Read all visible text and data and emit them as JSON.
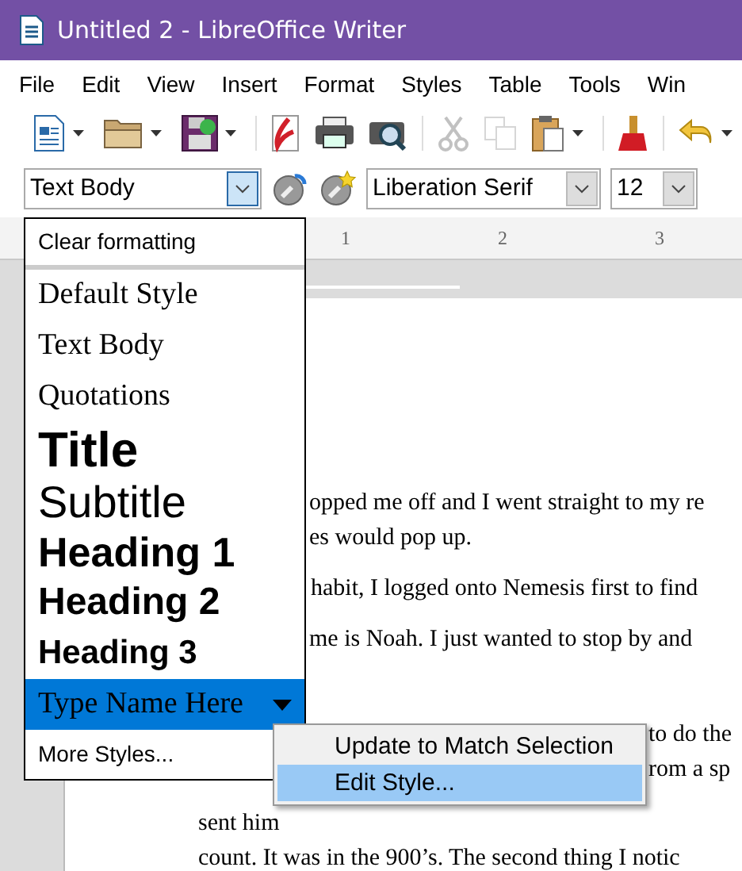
{
  "window": {
    "title": "Untitled 2 - LibreOffice Writer"
  },
  "menu_bar": [
    "File",
    "Edit",
    "View",
    "Insert",
    "Format",
    "Styles",
    "Table",
    "Tools",
    "Win"
  ],
  "standard_toolbar": [
    {
      "kind": "new",
      "disabled": false
    },
    {
      "kind": "open",
      "disabled": false
    },
    {
      "kind": "save",
      "disabled": false
    },
    {
      "kind": "pdf",
      "disabled": false
    },
    {
      "kind": "print",
      "disabled": false
    },
    {
      "kind": "preview",
      "disabled": false
    },
    {
      "kind": "cut",
      "disabled": true
    },
    {
      "kind": "copy",
      "disabled": true
    },
    {
      "kind": "paste",
      "disabled": false
    },
    {
      "kind": "brush",
      "disabled": false
    },
    {
      "kind": "undo",
      "disabled": false
    }
  ],
  "formatting_toolbar": {
    "paragraph_style": "Text Body",
    "font_name": "Liberation Serif",
    "font_size": "12"
  },
  "ruler": [
    "1",
    "2",
    "3"
  ],
  "document": {
    "lines": [
      {
        "text": "opped me off and I went straight to my re"
      },
      {
        "text": "es would pop up."
      },
      {
        "text": "habit, I logged onto Nemesis first to find"
      },
      {
        "text": "me is Noah. I just wanted to stop by and"
      },
      {
        "text": "to do the"
      },
      {
        "text": "rom a sp"
      },
      {
        "text": "sent him"
      },
      {
        "text": "count. It was in the 900’s. The second thing I notic"
      }
    ]
  },
  "style_menu": {
    "items": [
      {
        "label": "Clear formatting",
        "kind": "clear",
        "selected": false
      },
      {
        "label": "Default Style",
        "kind": "default",
        "selected": false
      },
      {
        "label": "Text Body",
        "kind": "default",
        "selected": false
      },
      {
        "label": "Quotations",
        "kind": "default",
        "selected": false
      },
      {
        "label": "Title",
        "kind": "title",
        "selected": false
      },
      {
        "label": "Subtitle",
        "kind": "subtitle",
        "selected": false
      },
      {
        "label": "Heading 1",
        "kind": "heading1",
        "selected": false
      },
      {
        "label": "Heading 2",
        "kind": "heading2",
        "selected": false
      },
      {
        "label": "Heading 3",
        "kind": "heading3",
        "selected": false
      },
      {
        "label": "Type Name Here",
        "kind": "default",
        "selected": true
      },
      {
        "label": "More Styles...",
        "kind": "more",
        "selected": false
      }
    ]
  },
  "context_menu": {
    "items": [
      {
        "label": "Update to Match Selection",
        "selected": false
      },
      {
        "label": "Edit Style...",
        "selected": true
      }
    ]
  }
}
